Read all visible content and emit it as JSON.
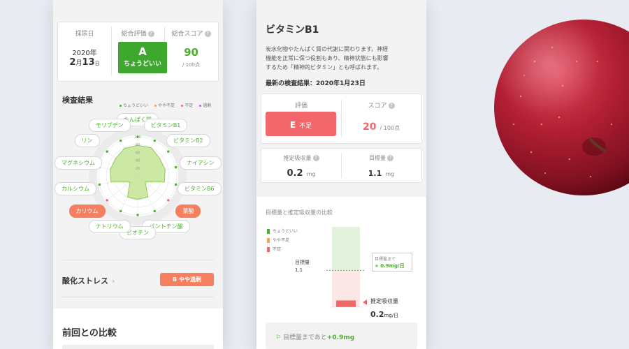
{
  "summary": {
    "date_label": "採尿日",
    "year": "2020年",
    "month": "2",
    "month_unit": "月",
    "day": "13",
    "day_unit": "日",
    "grade_label": "総合評価",
    "grade": "A",
    "grade_text": "ちょうどいい",
    "score_label": "総合スコア",
    "score": "90",
    "score_unit": "/ 100点"
  },
  "results": {
    "title": "検査結果",
    "legend": [
      {
        "label": "ちょうどいい",
        "color": "#4dae2f"
      },
      {
        "label": "やや不足",
        "color": "#f5a050"
      },
      {
        "label": "不足",
        "color": "#f0666a"
      },
      {
        "label": "過剰",
        "color": "#b45fc9"
      }
    ],
    "nutrients": [
      "たんぱく質",
      "ビタミンB1",
      "ビタミンB2",
      "ナイアシン",
      "ビタミンB6",
      "葉酸",
      "パントテン酸",
      "ビオチン",
      "ナトリウム",
      "カリウム",
      "カルシウム",
      "マグネシウム",
      "リン",
      "モリブデン"
    ],
    "alert_nutrients": [
      "葉酸",
      "カリウム"
    ],
    "scale_ticks": [
      "100",
      "80",
      "60",
      "40",
      "20"
    ],
    "radar_values": [
      78,
      80,
      72,
      72,
      70,
      25,
      60,
      60,
      60,
      25,
      70,
      72,
      72,
      78
    ],
    "radar_colors": {
      "fill": "#c7e59a",
      "stroke": "#8fc95c",
      "normal_point": "#4dae2f",
      "alert_point": "#f0666a"
    }
  },
  "oxidative": {
    "label": "酸化ストレス",
    "badge_grade": "B",
    "badge_text": "やや過剰"
  },
  "comparison": {
    "title": "前回との比較"
  },
  "vitamin": {
    "name": "ビタミンB1",
    "description_lines": [
      "炭水化物やたんぱく質の代謝に関わります。神経",
      "機能を正常に保つ役割もあり、精神状態にも影響",
      "するため「精神的ビタミン」とも呼ばれます。"
    ],
    "latest_label": "最新の検査結果：2020年1月23日",
    "eval_label": "評価",
    "eval_grade": "E",
    "eval_text": "不足",
    "score_label": "スコア",
    "score": "20",
    "score_unit": "/ 100点",
    "intake_label": "推定吸収量",
    "intake_value": "0.2",
    "intake_unit": "mg",
    "target_label": "目標量",
    "target_value": "1.1",
    "target_unit": "mg",
    "chart_title": "目標量と推定吸収量の比較",
    "chart_legend": [
      {
        "label": "ちょうどいい",
        "color": "#4dae2f"
      },
      {
        "label": "やや不足",
        "color": "#f5a050"
      },
      {
        "label": "不足",
        "color": "#f0666a"
      }
    ],
    "target_marker_label": "目標量",
    "target_marker_value": "1.1",
    "gap_label": "目標量まで",
    "gap_value": "+ 0.9mg/日",
    "intake_marker_label": "推定吸収量",
    "intake_marker_value": "0.2",
    "intake_marker_unit": "mg/日",
    "footer_text": "目標量まであと",
    "footer_value": "+0.9mg"
  },
  "chart_data": {
    "type": "bar",
    "title": "目標量と推定吸収量の比較",
    "categories": [
      "推定吸収量"
    ],
    "values": [
      0.2
    ],
    "target": 1.1,
    "ylim": [
      0,
      2.4
    ]
  }
}
